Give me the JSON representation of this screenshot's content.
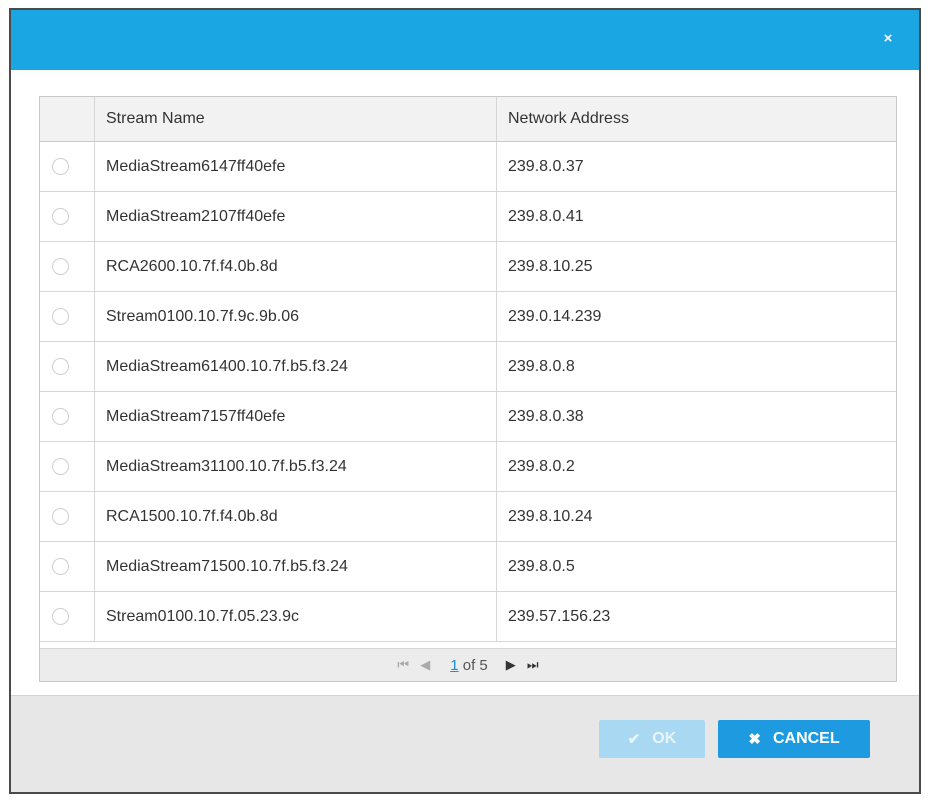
{
  "dialog": {
    "close_icon": "×"
  },
  "table": {
    "headers": {
      "name": "Stream Name",
      "address": "Network Address"
    },
    "rows": [
      {
        "name": "MediaStream6147ff40efe",
        "address": "239.8.0.37"
      },
      {
        "name": "MediaStream2107ff40efe",
        "address": "239.8.0.41"
      },
      {
        "name": "RCA2600.10.7f.f4.0b.8d",
        "address": "239.8.10.25"
      },
      {
        "name": "Stream0100.10.7f.9c.9b.06",
        "address": "239.0.14.239"
      },
      {
        "name": "MediaStream61400.10.7f.b5.f3.24",
        "address": "239.8.0.8"
      },
      {
        "name": "MediaStream7157ff40efe",
        "address": "239.8.0.38"
      },
      {
        "name": "MediaStream31100.10.7f.b5.f3.24",
        "address": "239.8.0.2"
      },
      {
        "name": "RCA1500.10.7f.f4.0b.8d",
        "address": "239.8.10.24"
      },
      {
        "name": "MediaStream71500.10.7f.b5.f3.24",
        "address": "239.8.0.5"
      },
      {
        "name": "Stream0100.10.7f.05.23.9c",
        "address": "239.57.156.23"
      }
    ]
  },
  "pager": {
    "first_icon": "⏮",
    "prev_icon": "◀",
    "next_icon": "▶",
    "last_icon": "⏭",
    "current_page": "1",
    "of_text": " of 5"
  },
  "footer": {
    "ok_label": "OK",
    "ok_icon": "✔",
    "cancel_label": "CANCEL",
    "cancel_icon": "✖"
  },
  "colors": {
    "titlebar": "#1aa5e3",
    "cancel_button": "#1e9be0",
    "ok_button_disabled": "#a9d9f2",
    "pager_link": "#1a8fd6"
  }
}
